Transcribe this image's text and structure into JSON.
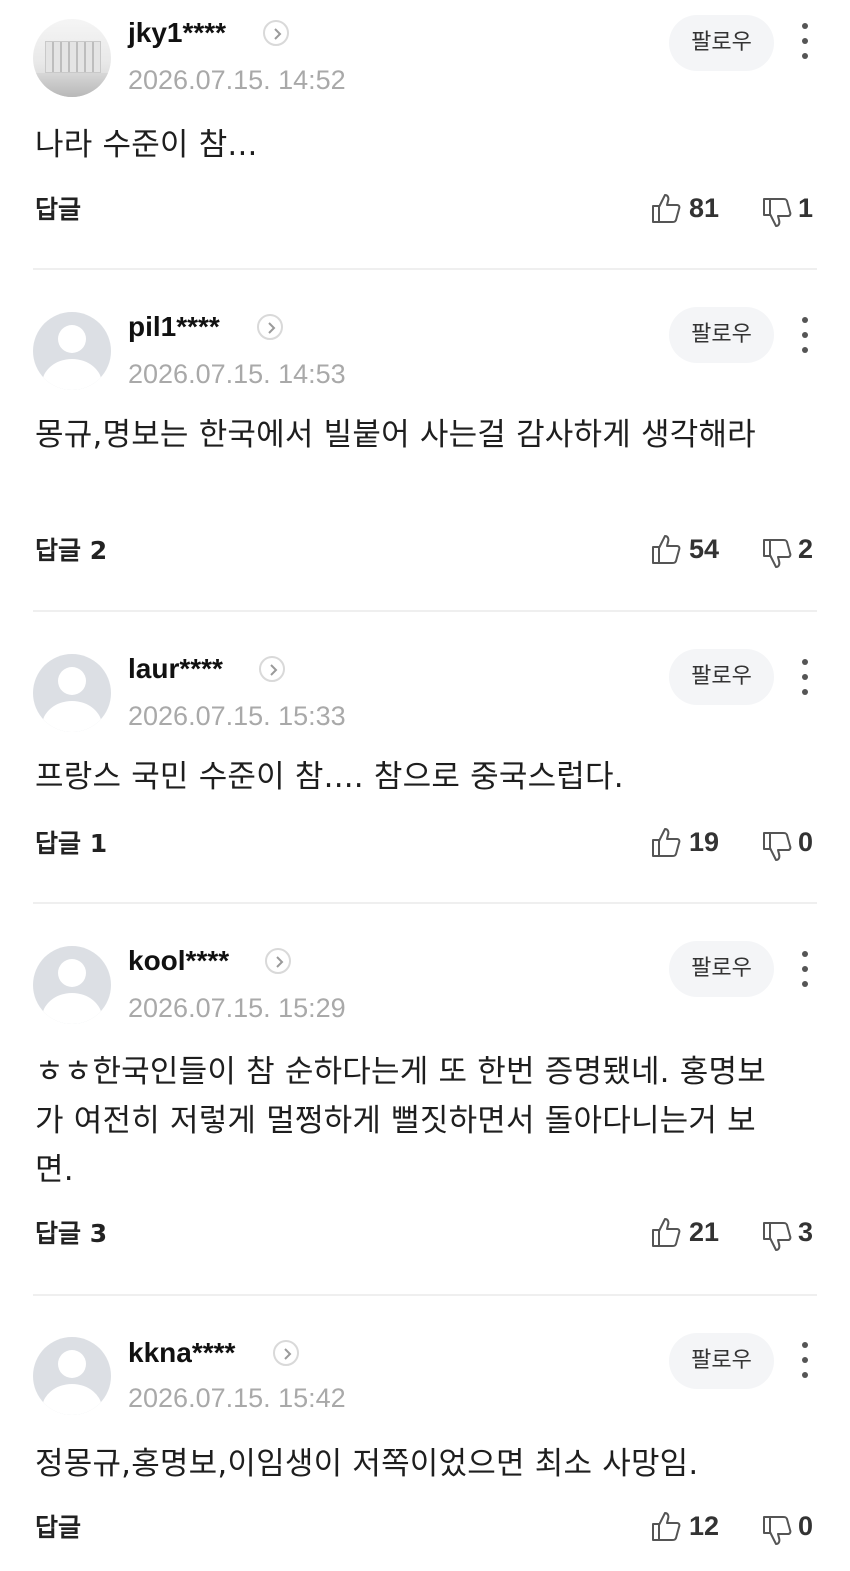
{
  "comments": [
    {
      "username": "jky1****",
      "timestamp": "2026.07.15. 14:52",
      "text": "나라 수준이 참...",
      "follow_label": "팔로우",
      "reply_label": "답글",
      "likes": "81",
      "dislikes": "1",
      "avatar": "photo"
    },
    {
      "username": "pil1****",
      "timestamp": "2026.07.15. 14:53",
      "text": "몽규,명보는 한국에서 빌붙어 사는걸 감사하게 생각해라",
      "follow_label": "팔로우",
      "reply_label": "답글 2",
      "likes": "54",
      "dislikes": "2",
      "avatar": "default"
    },
    {
      "username": "laur****",
      "timestamp": "2026.07.15. 15:33",
      "text": "프랑스 국민 수준이 참.... 참으로 중국스럽다.",
      "follow_label": "팔로우",
      "reply_label": "답글 1",
      "likes": "19",
      "dislikes": "0",
      "avatar": "default"
    },
    {
      "username": "kool****",
      "timestamp": "2026.07.15. 15:29",
      "text": "ㅎㅎ한국인들이 참 순하다는게 또 한번 증명됐네. 홍명보가 여전히 저렇게 멀쩡하게 뻘짓하면서 돌아다니는거 보면.",
      "follow_label": "팔로우",
      "reply_label": "답글 3",
      "likes": "21",
      "dislikes": "3",
      "avatar": "default"
    },
    {
      "username": "kkna****",
      "timestamp": "2026.07.15. 15:42",
      "text": "정몽규,홍명보,이임생이 저쪽이었으면 최소 사망임.",
      "follow_label": "팔로우",
      "reply_label": "답글",
      "likes": "12",
      "dislikes": "0",
      "avatar": "default"
    }
  ],
  "icons": {
    "like": "thumbs-up-icon",
    "dislike": "thumbs-down-icon",
    "more": "more-vertical-icon",
    "profile_link": "chevron-right-icon"
  },
  "colors": {
    "timestamp": "#a9a9a9",
    "divider": "#efefef",
    "follow_bg": "#f4f5f7"
  }
}
